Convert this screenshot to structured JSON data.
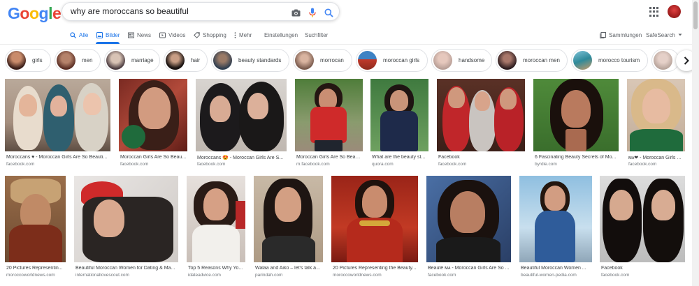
{
  "logo": {
    "letters": [
      "G",
      "o",
      "o",
      "g",
      "l",
      "e"
    ],
    "colors": [
      "#4285f4",
      "#ea4335",
      "#fbbc05",
      "#4285f4",
      "#34a853",
      "#ea4335"
    ]
  },
  "search": {
    "query": "why are moroccans so beautiful",
    "icons": [
      "camera-icon",
      "microphone-icon",
      "search-icon"
    ]
  },
  "tabs": {
    "alle": "Alle",
    "bilder": "Bilder",
    "news": "News",
    "videos": "Videos",
    "shopping": "Shopping",
    "mehr": "Mehr",
    "einstellungen": "Einstellungen",
    "suchfilter": "Suchfilter",
    "sammlungen": "Sammlungen",
    "safesearch": "SafeSearch"
  },
  "chips": [
    "girls",
    "men",
    "marriage",
    "hair",
    "beauty standards",
    "morrocan",
    "moroccan girls",
    "handsome",
    "moroccan men",
    "morocco tourism"
  ],
  "results": [
    {
      "caption": "Moroccans ♥ - Moroccan Girls Are So Beauti...",
      "source": "facebook.com"
    },
    {
      "caption": "Moroccan Girls Are So Beau...",
      "source": "facebook.com"
    },
    {
      "caption": "Moroccans 😍 - Moroccan Girls Are S...",
      "source": "facebook.com"
    },
    {
      "caption": "Moroccan Girls Are So Beaut...",
      "source": "m.facebook.com"
    },
    {
      "caption": "What are the beauty st...",
      "source": "quora.com"
    },
    {
      "caption": "Facebook",
      "source": "facebook.com"
    },
    {
      "caption": "6 Fascinating Beauty Secrets of Mo...",
      "source": "byrdie.com"
    },
    {
      "caption": "ᴍᴀ❤ - Moroccan Girls ...",
      "source": "facebook.com"
    },
    {
      "caption": "20 Pictures Representin...",
      "source": "moroccoworldnews.com"
    },
    {
      "caption": "Beautiful Moroccan Women for Dating & Ma...",
      "source": "internationallovescout.com"
    },
    {
      "caption": "Top 5 Reasons Why Yo...",
      "source": "idateadvice.com"
    },
    {
      "caption": "Walaa and Aiko – let's talk a...",
      "source": "parindah.com"
    },
    {
      "caption": "20 Pictures Representing the Beauty...",
      "source": "moroccoworldnews.com"
    },
    {
      "caption": "Beauté ᴍᴀ - Moroccan Girls Are So ...",
      "source": "facebook.com"
    },
    {
      "caption": "Beautiful Moroccan Women ...",
      "source": "beautiful-women-pedia.com"
    },
    {
      "caption": "Facebook",
      "source": "facebook.com"
    }
  ]
}
